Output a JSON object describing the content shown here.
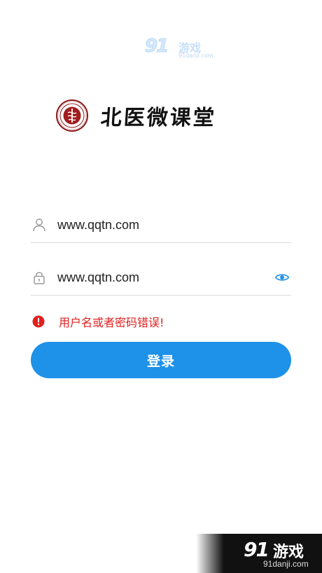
{
  "watermark_top": {
    "brand_number": "91",
    "brand_text": "游戏",
    "url": "91danji.com"
  },
  "app": {
    "title": "北医微课堂"
  },
  "username": {
    "value": "www.qqtn.com",
    "icon": "user-icon"
  },
  "password": {
    "value": "www.qqtn.com",
    "icon": "lock-icon",
    "toggle_icon": "eye-icon"
  },
  "error": {
    "message": "用户名或者密码错误!",
    "icon": "error-icon",
    "color": "#e02020"
  },
  "login_button": {
    "label": "登录",
    "color": "#1e91e8"
  },
  "watermark_bottom": {
    "brand_number": "91",
    "brand_text": "游戏",
    "url": "91danji.com"
  }
}
